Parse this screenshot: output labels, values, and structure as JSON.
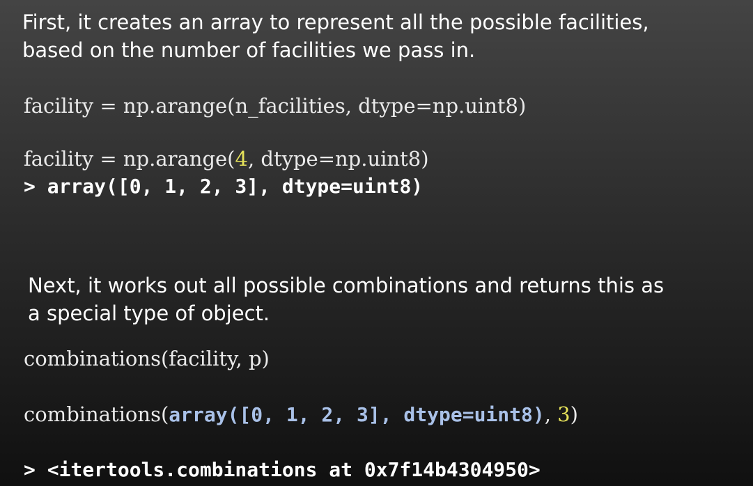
{
  "intro": {
    "line1": "First, it creates an array to represent all the possible facilities,",
    "line2": "based on the number of facilities we pass in."
  },
  "code1": {
    "line": "facility = np.arange(n_facilities, dtype=np.uint8)"
  },
  "code2": {
    "prefix": "facility = np.arange(",
    "arg_number": "4",
    "suffix": ", dtype=np.uint8)"
  },
  "output1": {
    "line": "> array([0, 1, 2, 3], dtype=uint8)"
  },
  "next": {
    "line1": "Next, it works out all possible combinations and returns this as",
    "line2": "a special type of object."
  },
  "code3": {
    "line": "combinations(facility, p)"
  },
  "code4": {
    "prefix": "combinations(",
    "array_part": "array([0, 1, 2, 3], dtype=uint8)",
    "comma": ", ",
    "number": "3",
    "close": ")"
  },
  "output2": {
    "line": "> <itertools.combinations at 0x7f14b4304950>"
  },
  "colors": {
    "background_top": "#444444",
    "background_bottom": "#101010",
    "text": "#ffffff",
    "highlight_yellow": "#e6e25a",
    "highlight_blue": "#a9c1e8"
  }
}
